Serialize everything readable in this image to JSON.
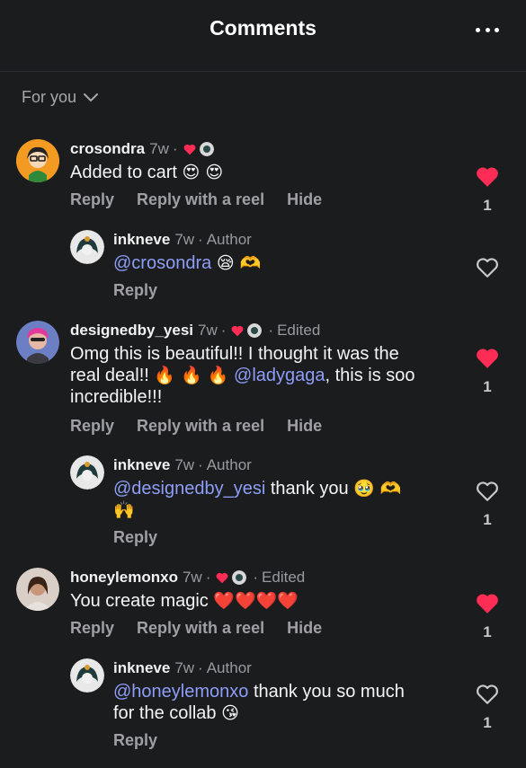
{
  "header": {
    "title": "Comments"
  },
  "filter": {
    "label": "For you"
  },
  "colors": {
    "background": "#1b1c1e",
    "heart": "#ff2d55",
    "mention": "#8e9ef8",
    "muted": "#a0a0a4"
  },
  "comments": [
    {
      "username": "crosondra",
      "time": "7w",
      "edited": "",
      "text": "Added to cart",
      "emoji": "😍 😍",
      "actions": [
        "Reply",
        "Reply with a reel",
        "Hide"
      ],
      "likes": "1",
      "liked": true
    },
    {
      "username": "inkneve",
      "time": "7w",
      "role": "Author",
      "mention": "@crosondra",
      "text": "",
      "emoji": "😪 🫶",
      "actions": [
        "Reply"
      ],
      "likes": "",
      "liked": false
    },
    {
      "username": "designedby_yesi",
      "time": "7w",
      "edited": "Edited",
      "text_line1": "Omg this is beautiful!! I thought it was the",
      "text_line2a": "real deal!!",
      "text_line2b_emoji": "🔥 🔥 🔥",
      "mention": "@ladygaga",
      "text_line2c": ", this is soo",
      "text_line3": "incredible!!!",
      "actions": [
        "Reply",
        "Reply with a reel",
        "Hide"
      ],
      "likes": "1",
      "liked": true
    },
    {
      "username": "inkneve",
      "time": "7w",
      "role": "Author",
      "mention": "@designedby_yesi",
      "text": " thank you",
      "emoji": "🥹 🫶",
      "emoji2": "🙌",
      "actions": [
        "Reply"
      ],
      "likes": "1",
      "liked": false
    },
    {
      "username": "honeylemonxo",
      "time": "7w",
      "edited": "Edited",
      "text": "You create magic",
      "emoji": "❤️❤️❤️❤️",
      "actions": [
        "Reply",
        "Reply with a reel",
        "Hide"
      ],
      "likes": "1",
      "liked": true
    },
    {
      "username": "inkneve",
      "time": "7w",
      "role": "Author",
      "mention": "@honeylemonxo",
      "text": " thank you so much",
      "text_line2": "for the collab",
      "emoji": "😘",
      "actions": [
        "Reply"
      ],
      "likes": "1",
      "liked": false
    }
  ]
}
